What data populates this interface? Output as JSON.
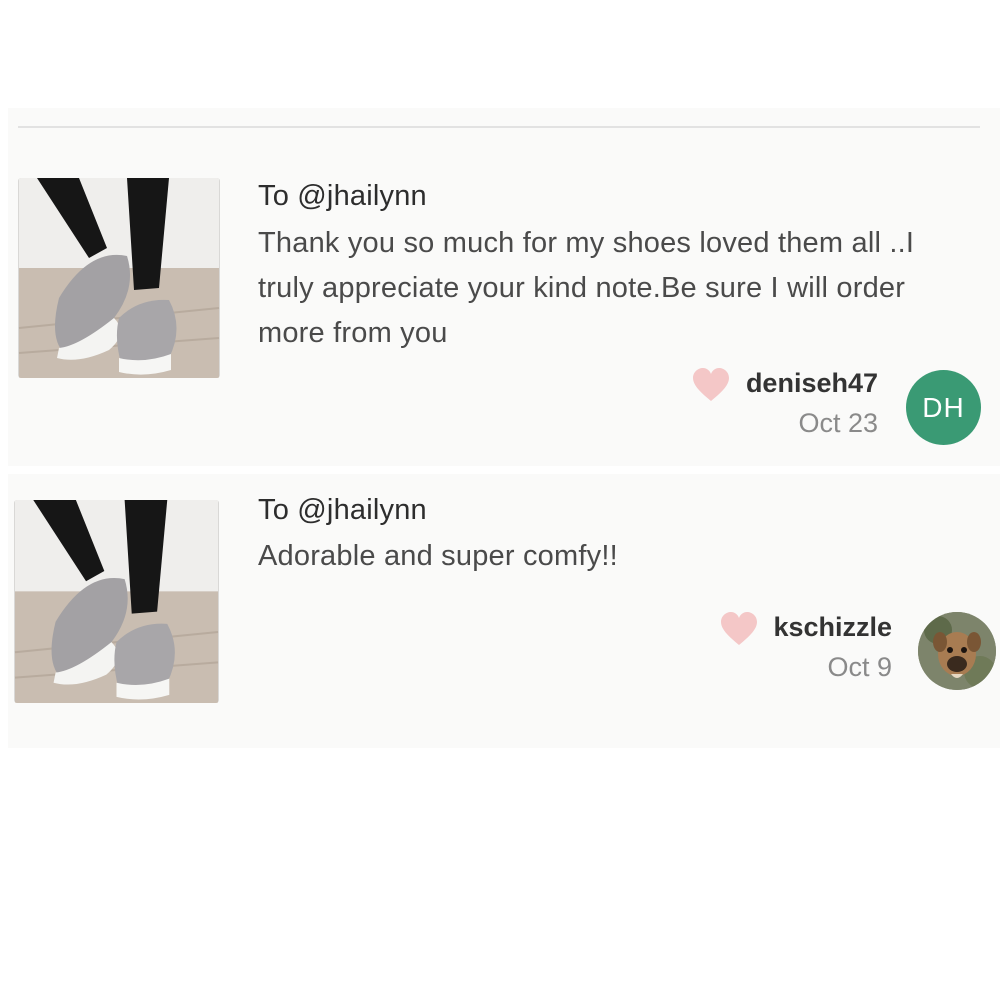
{
  "notes": [
    {
      "recipient": "To @jhailynn",
      "message": "Thank you so much for my shoes loved them all ..I truly appreciate your kind note.Be sure I will order more from you",
      "username": "deniseh47",
      "date": "Oct 23",
      "avatar_initials": "DH",
      "avatar_color": "#3a9a74",
      "product_image": "gray-slip-on-sneakers-photo"
    },
    {
      "recipient": "To @jhailynn",
      "message": "Adorable and super comfy!!",
      "username": "kschizzle",
      "date": "Oct 9",
      "avatar_image": "dog-photo",
      "product_image": "gray-slip-on-sneakers-photo"
    }
  ],
  "colors": {
    "heart": "#f4c7c7",
    "panel_background": "#fafaf9"
  }
}
